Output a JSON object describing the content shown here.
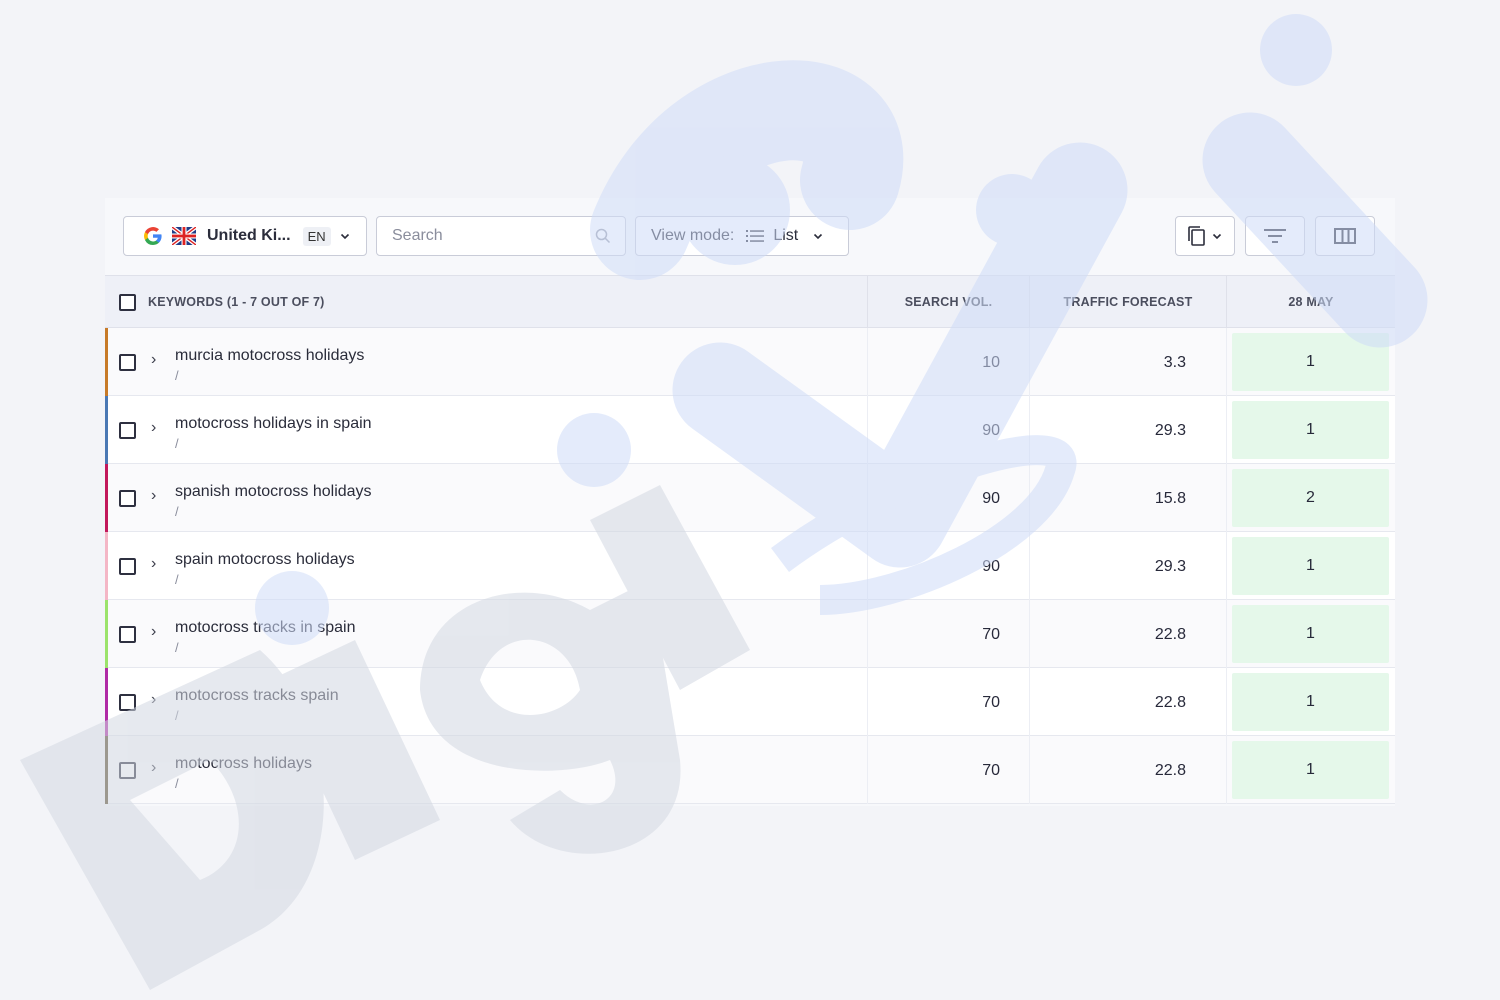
{
  "toolbar": {
    "region_label": "United Ki...",
    "language": "EN",
    "search_placeholder": "Search",
    "view_mode_label": "View mode:",
    "view_mode_value": "List"
  },
  "table": {
    "header": {
      "keywords": "KEYWORDS (1 - 7 OUT OF 7)",
      "search_vol": "SEARCH VOL.",
      "traffic_forecast": "TRAFFIC FORECAST",
      "date": "28 MAY"
    },
    "rows": [
      {
        "keyword": "murcia motocross holidays",
        "url": "/",
        "search_vol": "10",
        "traffic": "3.3",
        "position": "1",
        "color": "#c77a28"
      },
      {
        "keyword": "motocross holidays in spain",
        "url": "/",
        "search_vol": "90",
        "traffic": "29.3",
        "position": "1",
        "color": "#4a78b4"
      },
      {
        "keyword": "spanish motocross holidays",
        "url": "/",
        "search_vol": "90",
        "traffic": "15.8",
        "position": "2",
        "color": "#c2185b"
      },
      {
        "keyword": "spain motocross holidays",
        "url": "/",
        "search_vol": "90",
        "traffic": "29.3",
        "position": "1",
        "color": "#f4b6c6"
      },
      {
        "keyword": "motocross tracks in spain",
        "url": "/",
        "search_vol": "70",
        "traffic": "22.8",
        "position": "1",
        "color": "#9be36b"
      },
      {
        "keyword": "motocross tracks spain",
        "url": "/",
        "search_vol": "70",
        "traffic": "22.8",
        "position": "1",
        "color": "#b02aa6"
      },
      {
        "keyword": "motocross holidays",
        "url": "/",
        "search_vol": "70",
        "traffic": "22.8",
        "position": "1",
        "color": "#5a4a2a"
      }
    ]
  },
  "icons": {
    "engine": "google-icon",
    "flag": "uk-flag-icon",
    "search": "search-icon",
    "list": "list-icon",
    "copy": "copy-icon",
    "filter": "filter-icon",
    "columns": "columns-icon"
  },
  "colors": {
    "position_bg": "#e5f8ea",
    "watermark_blue": "#d9e4fb",
    "watermark_grey": "#dde1ea"
  },
  "watermark": "DigiVisi"
}
